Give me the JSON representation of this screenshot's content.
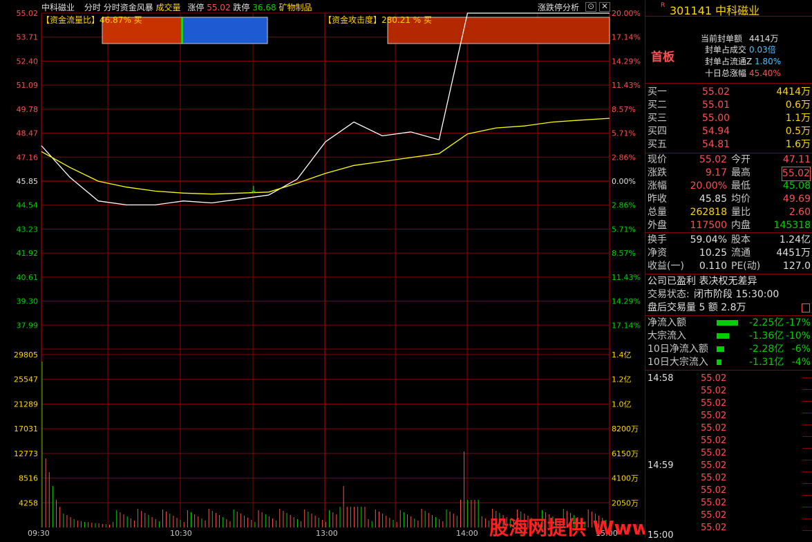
{
  "header": {
    "stock_name": "中科磁业",
    "mode": "分时",
    "indicator": "分时资金风暴",
    "volume_label": "成交量",
    "limit_up_label": "涨停",
    "limit_up": "55.02",
    "limit_down_label": "跌停",
    "limit_down": "36.68",
    "industry": "矿物制品",
    "analysis_button": "涨跌停分析",
    "window_restore": "⊙",
    "window_close": "✕"
  },
  "price_axis_left": [
    "55.02",
    "53.71",
    "52.40",
    "51.09",
    "49.78",
    "48.47",
    "47.16",
    "45.85",
    "44.54",
    "43.23",
    "41.92",
    "40.61",
    "39.30",
    "37.99"
  ],
  "pct_axis_right": [
    "20.00%",
    "17.14%",
    "14.29%",
    "11.43%",
    "8.57%",
    "5.71%",
    "2.86%",
    "0.00%",
    "2.86%",
    "5.71%",
    "8.57%",
    "11.43%",
    "14.29%",
    "17.14%"
  ],
  "volume_axis_left": [
    "29805",
    "25547",
    "21289",
    "17031",
    "12773",
    "8516",
    "4258"
  ],
  "volume_axis_right": [
    "1.4亿",
    "1.2亿",
    "1.0亿",
    "8200万",
    "6150万",
    "4100万",
    "2050万"
  ],
  "time_axis": [
    "09:30",
    "10:30",
    "13:00",
    "14:00",
    "15:00"
  ],
  "indicator_labels": {
    "flow_ratio": "【资金流量比】46.87% 买",
    "attack": "【资金攻击度】280.21 % 买"
  },
  "colors": {
    "up": "#ff5050",
    "down": "#00d000",
    "grid": "#8b0000",
    "price_line": "#ffffff",
    "avg_line": "#ffff00"
  },
  "quote": {
    "code_prefix": "R",
    "code": "301141",
    "name": "中科磁业",
    "board": "首板",
    "seal_amount_label": "当前封单额",
    "seal_amount": "4414万",
    "seal_vol_label": "封单占成交",
    "seal_vol": "0.03倍",
    "seal_float_label": "封单占流通Z",
    "seal_float": "1.80%",
    "ten_day_label": "十日总涨幅",
    "ten_day": "45.40%",
    "bids": [
      {
        "label": "买一",
        "price": "55.02",
        "vol": "4414万"
      },
      {
        "label": "买二",
        "price": "55.01",
        "vol": "0.6万"
      },
      {
        "label": "买三",
        "price": "55.00",
        "vol": "1.1万"
      },
      {
        "label": "买四",
        "price": "54.94",
        "vol": "0.5万"
      },
      {
        "label": "买五",
        "price": "54.81",
        "vol": "1.6万"
      }
    ],
    "stats": [
      {
        "l1": "现价",
        "v1": "55.02",
        "c1": "red",
        "l2": "今开",
        "v2": "47.11",
        "c2": "red"
      },
      {
        "l1": "涨跌",
        "v1": "9.17",
        "c1": "red",
        "l2": "最高",
        "v2": "55.02",
        "c2": "red"
      },
      {
        "l1": "涨幅",
        "v1": "20.00%",
        "c1": "red",
        "l2": "最低",
        "v2": "45.08",
        "c2": "green"
      },
      {
        "l1": "昨收",
        "v1": "45.85",
        "c1": "white",
        "l2": "均价",
        "v2": "49.69",
        "c2": "red"
      },
      {
        "l1": "总量",
        "v1": "262818",
        "c1": "yellow",
        "l2": "量比",
        "v2": "2.60",
        "c2": "red"
      },
      {
        "l1": "外盘",
        "v1": "117500",
        "c1": "red",
        "l2": "内盘",
        "v2": "145318",
        "c2": "green"
      }
    ],
    "stats2": [
      {
        "l1": "换手",
        "v1": "59.04%",
        "l2": "股本",
        "v2": "1.24亿"
      },
      {
        "l1": "净资",
        "v1": "10.25",
        "l2": "流通",
        "v2": "4451万"
      },
      {
        "l1": "收益(一)",
        "v1": "0.110",
        "l2": "PE(动)",
        "v2": "127.0"
      }
    ],
    "notice": "公司已盈利 表决权无差异",
    "status_label": "交易状态:",
    "status_value": "闭市阶段 15:30:00",
    "after_hours": "盘后交易量 5 额 2.8万",
    "flows": [
      {
        "label": "净流入额",
        "value": "-2.25亿",
        "pct": "-17%",
        "bar": 0.85
      },
      {
        "label": "大宗流入",
        "value": "-1.36亿",
        "pct": "-10%",
        "bar": 0.5
      },
      {
        "label": "10日净流入额",
        "value": "-2.28亿",
        "pct": "-6%",
        "bar": 0.3
      },
      {
        "label": "10日大宗流入",
        "value": "-1.31亿",
        "pct": "-4%",
        "bar": 0.2
      }
    ],
    "ticks1": {
      "time": "14:58",
      "prices": [
        "55.02",
        "55.02",
        "55.02",
        "55.02",
        "55.02",
        "55.02",
        "55.02"
      ]
    },
    "ticks2": {
      "time": "14:59",
      "prices": [
        "55.02",
        "55.02",
        "55.02",
        "55.02",
        "55.02",
        "55.02"
      ]
    },
    "ticks3": {
      "time": "15:00"
    }
  },
  "watermark": "股海网提供 Www.Guhai.Com.CN",
  "chart_data": {
    "type": "line",
    "title": "中科磁业 分时",
    "prev_close": 45.85,
    "ylim": [
      37.99,
      55.02
    ],
    "x": [
      "09:30",
      "09:45",
      "10:00",
      "10:15",
      "10:30",
      "10:45",
      "11:00",
      "11:15",
      "11:30",
      "13:00",
      "13:05",
      "13:10",
      "13:15",
      "13:20",
      "13:25",
      "13:30",
      "13:35",
      "13:40",
      "14:00",
      "14:30",
      "15:00"
    ],
    "series": [
      {
        "values": [
          48.3,
          46.7,
          45.5,
          45.3,
          45.3,
          45.5,
          45.4,
          45.6,
          45.8,
          46.6,
          48.5,
          49.5,
          48.8,
          49.0,
          48.6,
          55.02,
          55.02,
          55.02,
          55.02,
          55.02,
          55.02
        ]
      },
      {
        "values": [
          48.0,
          47.2,
          46.5,
          46.2,
          46.0,
          45.9,
          45.85,
          45.9,
          45.95,
          46.4,
          46.9,
          47.3,
          47.5,
          47.7,
          47.9,
          48.9,
          49.2,
          49.3,
          49.5,
          49.6,
          49.69
        ]
      }
    ]
  }
}
